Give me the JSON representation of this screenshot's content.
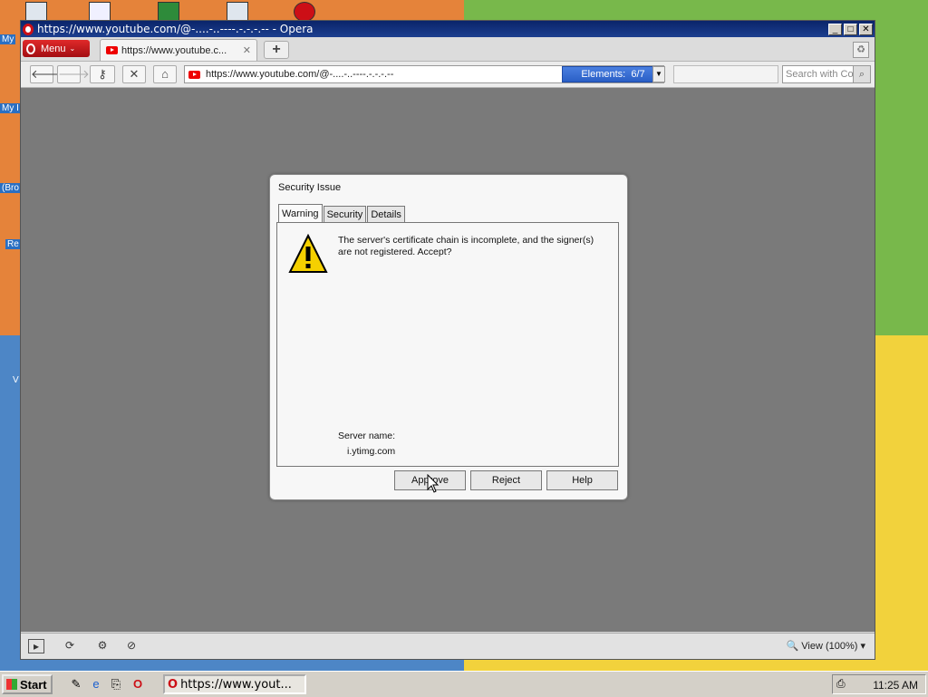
{
  "desktop": {
    "labels": [
      "My",
      "My I",
      "(Bro",
      "Re",
      "V"
    ]
  },
  "window": {
    "title": "https://www.youtube.com/@-....-..----.-.-.-.-- - Opera",
    "minimize": "_",
    "maximize": "□",
    "close": "✕"
  },
  "tabbar": {
    "menu_label": "Menu",
    "tab_label": "https://www.youtube.c...",
    "tab_close": "✕",
    "new_tab": "+"
  },
  "navbar": {
    "address": "https://www.youtube.com/@-....-..----.-.-.-.--",
    "elements_label": "Elements:",
    "elements_count": "6/7",
    "search_placeholder": "Search with Co"
  },
  "dialog": {
    "title": "Security Issue",
    "tabs": [
      "Warning",
      "Security",
      "Details"
    ],
    "message": "The server's certificate chain is incomplete, and the signer(s) are not registered. Accept?",
    "server_name_label": "Server name:",
    "server_name_value": "i.ytimg.com",
    "buttons": {
      "approve": "Approve",
      "reject": "Reject",
      "help": "Help"
    }
  },
  "statusbar": {
    "zoom": "View (100%)"
  },
  "taskbar": {
    "start": "Start",
    "task_label": "https://www.yout...",
    "clock": "11:25 AM"
  },
  "colors": {
    "titlebar": "#0a246a",
    "opera_red": "#cc0f16",
    "elements_blue": "#2a5fc6"
  }
}
